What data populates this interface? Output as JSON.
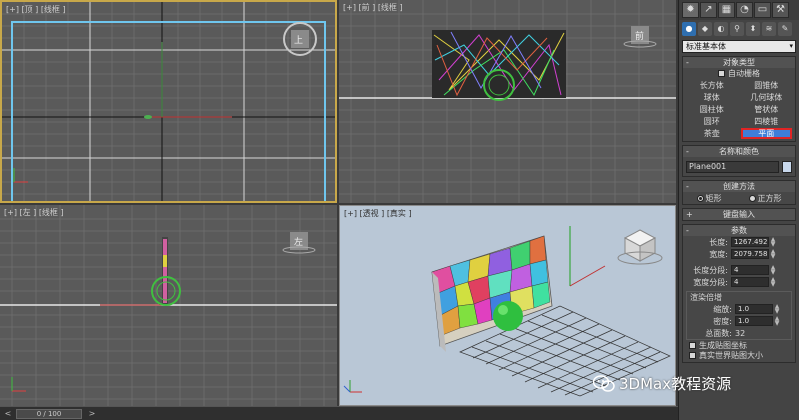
{
  "viewports": {
    "top_label": "[+] [顶 ] [线框 ]",
    "front_label": "[+] [前 ] [线框 ]",
    "left_label": "[+] [左 ] [线框 ]",
    "persp_label": "[+] [透视 ] [真实 ]",
    "cube_top": "上",
    "cube_front": "前",
    "cube_left": "左"
  },
  "timeline": {
    "frame_text": "0 / 100",
    "prev": "<",
    "next": ">"
  },
  "panel": {
    "tabs": [
      "✹",
      "↗",
      "▦",
      "◔",
      "▭",
      "⚒"
    ],
    "categories": [
      "●",
      "◆",
      "◐",
      "⚲",
      "⬍",
      "≋",
      "✎"
    ],
    "dropdown": "标准基本体",
    "object_type": {
      "title": "对象类型",
      "autogrid": "自动栅格",
      "buttons": [
        "长方体",
        "圆锥体",
        "球体",
        "几何球体",
        "圆柱体",
        "管状体",
        "圆环",
        "四棱锥",
        "茶壶",
        "平面"
      ],
      "selected": "平面"
    },
    "name_color": {
      "title": "名称和颜色",
      "name": "Plane001"
    },
    "creation": {
      "title": "创建方法",
      "opt1": "矩形",
      "opt2": "正方形"
    },
    "keyboard": {
      "title": "键盘输入"
    },
    "params": {
      "title": "参数",
      "length_label": "长度:",
      "length_value": "1267.492",
      "width_label": "宽度:",
      "width_value": "2079.758",
      "lseg_label": "长度分段:",
      "lseg_value": "4",
      "wseg_label": "宽度分段:",
      "wseg_value": "4",
      "render_title": "渲染倍增",
      "scale_label": "缩放:",
      "scale_value": "1.0",
      "density_label": "密度:",
      "density_value": "1.0",
      "faces_label": "总面数:",
      "faces_value": "32",
      "genmap": "生成贴图坐标",
      "realworld": "真实世界贴图大小"
    }
  },
  "watermark": "3DMax教程资源"
}
